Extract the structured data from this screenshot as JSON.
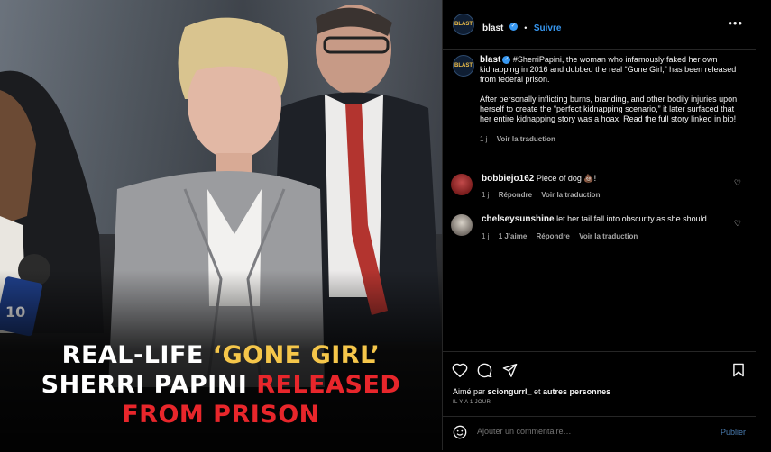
{
  "post": {
    "headline": {
      "line1_white": "REAL-LIFE ",
      "line1_yellow": "‘GONE GIRL’",
      "line2_white": "SHERRI PAPINI ",
      "line2_red": "RELEASED",
      "line3_red": "FROM PRISON"
    }
  },
  "header": {
    "avatar_text": "BLAST",
    "username": "blast",
    "separator": "•",
    "follow_label": "Suivre",
    "more_label": "•••"
  },
  "caption": {
    "username": "blast",
    "paragraph1": "#SherriPapini, the woman who infamously faked her own kidnapping in 2016 and dubbed the real “Gone Girl,” has been released from federal prison.",
    "paragraph2": "After personally inflicting burns, branding, and other bodily injuries upon herself to create the “perfect kidnapping scenario,” it later surfaced that her entire kidnapping story was a hoax. Read the full story linked in bio!",
    "time": "1 j",
    "translate": "Voir la traduction"
  },
  "comments": [
    {
      "username": "bobbiejo162",
      "text": "Piece of dog 💩!",
      "time": "1 j",
      "reply": "Répondre",
      "translate": "Voir la traduction"
    },
    {
      "username": "chelseysunshine",
      "text": "let her tail fall into obscurity as she should.",
      "time": "1 j",
      "likes": "1 J’aime",
      "reply": "Répondre",
      "translate": "Voir la traduction"
    }
  ],
  "footer": {
    "liked_prefix": "Aimé par ",
    "liked_user": "sciongurrl_",
    "liked_mid": " et ",
    "liked_others": "autres personnes",
    "timestamp": "IL Y A 1 JOUR",
    "comment_placeholder": "Ajouter un commentaire…",
    "publish_label": "Publier"
  },
  "icons": {
    "like": "heart-icon",
    "comment": "comment-icon",
    "share": "send-icon",
    "save": "bookmark-icon",
    "emoji": "emoji-icon",
    "verified": "verified-badge-icon"
  },
  "colors": {
    "accent": "#3797f0",
    "headline_yellow": "#f5c64a",
    "headline_red": "#e8262b"
  }
}
